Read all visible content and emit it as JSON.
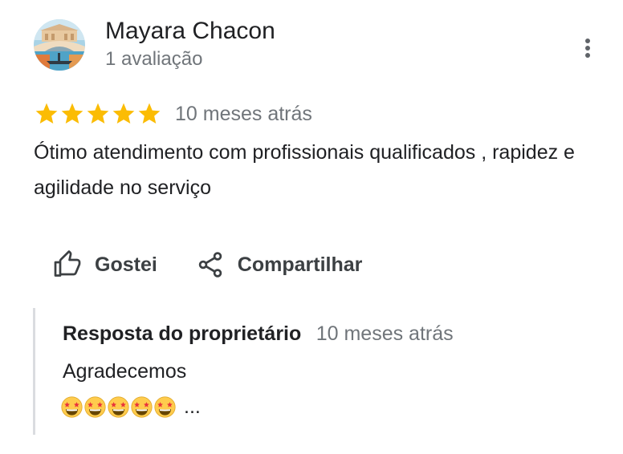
{
  "review": {
    "author_name": "Mayara Chacon",
    "author_meta": "1 avaliação",
    "avatar_icon": "venice-bridge-photo-icon",
    "more_icon": "more-vertical-icon",
    "rating": 5,
    "rating_max": 5,
    "star_color": "#fbbc04",
    "date": "10 meses atrás",
    "text": "Ótimo atendimento com profissionais qualificados , rapidez e agilidade no serviço"
  },
  "actions": {
    "like_label": "Gostei",
    "like_icon": "thumbs-up-icon",
    "share_label": "Compartilhar",
    "share_icon": "share-icon"
  },
  "owner_reply": {
    "title": "Resposta do proprietário",
    "date": "10 meses atrás",
    "text": "Agradecemos",
    "emoji_icon": "star-struck-emoji-icon",
    "emoji_count": 5,
    "ellipsis": "..."
  }
}
